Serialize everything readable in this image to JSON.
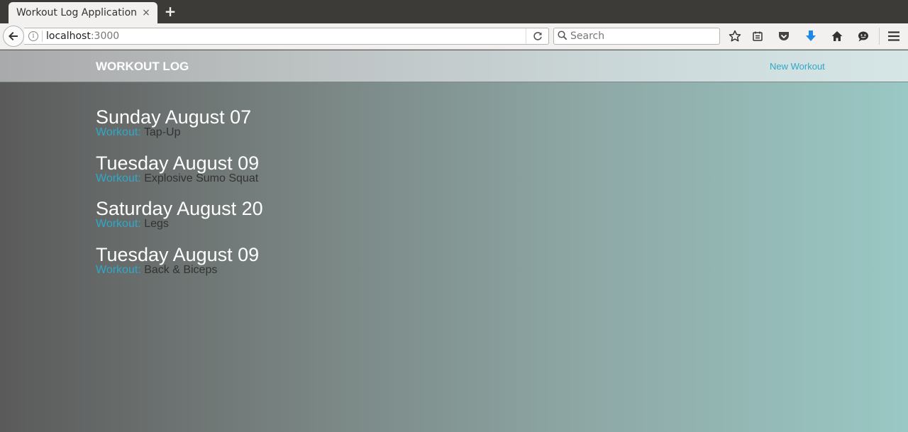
{
  "browser": {
    "tab_title": "Workout Log Application",
    "tab_close": "×",
    "new_tab": "+",
    "url_host": "localhost",
    "url_port": ":3000",
    "search_placeholder": "Search"
  },
  "header": {
    "brand": "WORKOUT LOG",
    "nav_link": "New Workout"
  },
  "colors": {
    "accent": "#2fa8c8",
    "download_arrow": "#1e88e5"
  },
  "workouts": [
    {
      "date": "Sunday August 07",
      "label": "Workout:",
      "name": "Tap-Up"
    },
    {
      "date": "Tuesday August 09",
      "label": "Workout:",
      "name": "Explosive Sumo Squat"
    },
    {
      "date": "Saturday August 20",
      "label": "Workout:",
      "name": "Legs"
    },
    {
      "date": "Tuesday August 09",
      "label": "Workout:",
      "name": "Back & Biceps"
    }
  ],
  "icons": [
    "back-arrow-icon",
    "info-icon",
    "reload-icon",
    "search-icon",
    "bookmark-star-icon",
    "reading-list-icon",
    "pocket-icon",
    "download-icon",
    "home-icon",
    "chat-icon",
    "hamburger-menu-icon"
  ]
}
